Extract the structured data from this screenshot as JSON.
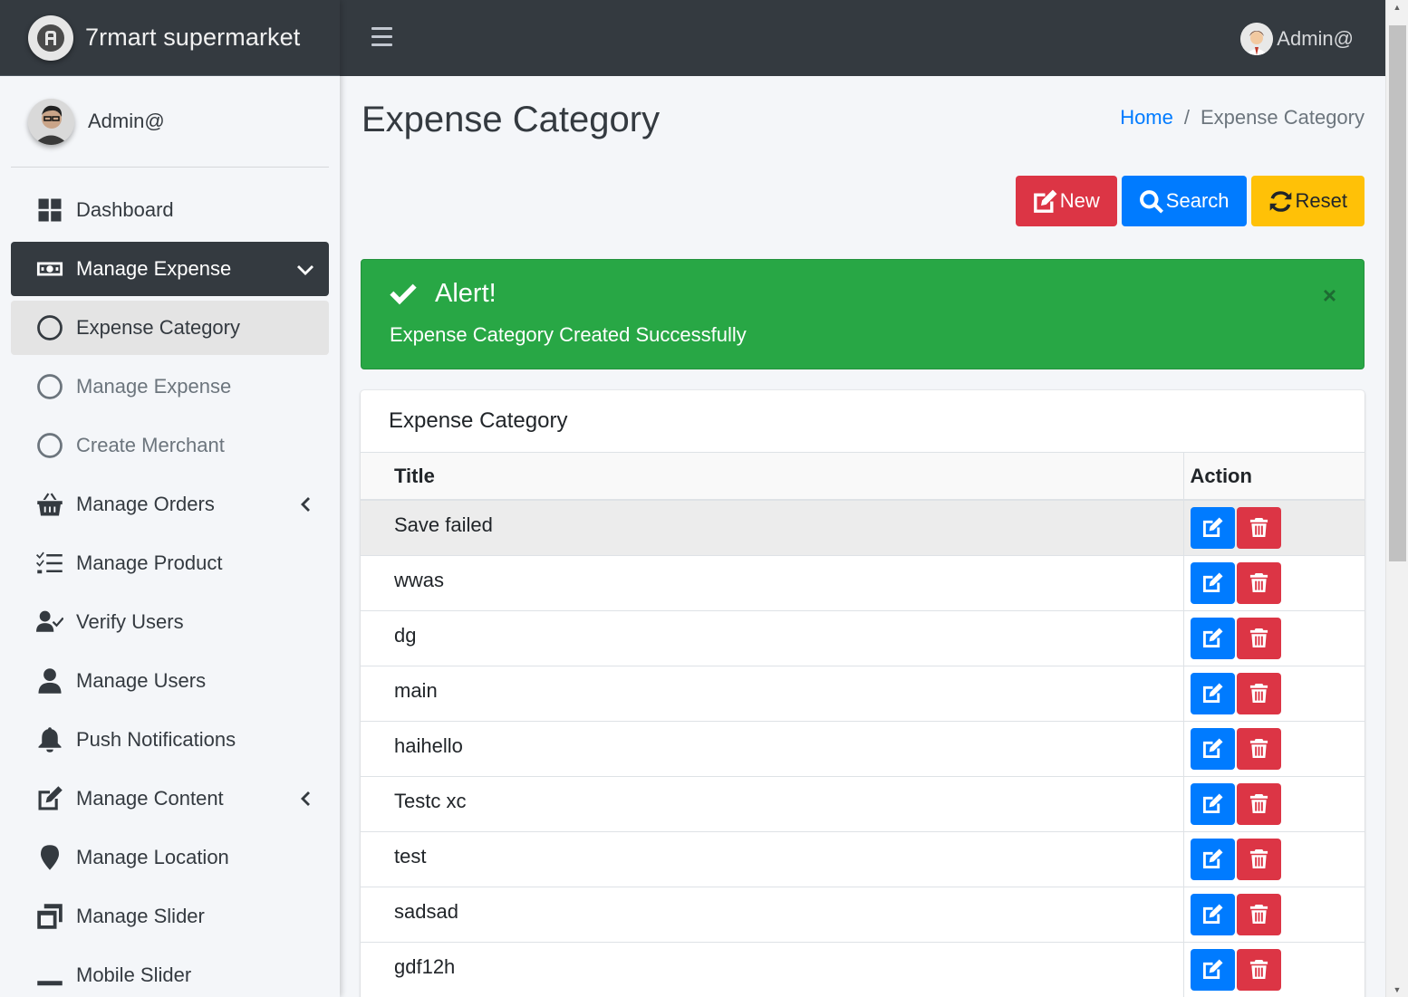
{
  "brand": {
    "name": "7rmart supermarket"
  },
  "user": {
    "name": "Admin@"
  },
  "topbar": {
    "user_name": "Admin@"
  },
  "sidebar": {
    "items": [
      {
        "label": "Dashboard",
        "icon": "dashboard-icon"
      },
      {
        "label": "Manage Expense",
        "icon": "money-bill-icon",
        "expanded": true
      },
      {
        "label": "Expense Category",
        "icon": "circle-icon"
      },
      {
        "label": "Manage Expense",
        "icon": "circle-icon"
      },
      {
        "label": "Create Merchant",
        "icon": "circle-icon"
      },
      {
        "label": "Manage Orders",
        "icon": "basket-icon"
      },
      {
        "label": "Manage Product",
        "icon": "tasks-icon"
      },
      {
        "label": "Verify Users",
        "icon": "user-check-icon"
      },
      {
        "label": "Manage Users",
        "icon": "user-icon"
      },
      {
        "label": "Push Notifications",
        "icon": "bell-icon"
      },
      {
        "label": "Manage Content",
        "icon": "edit-icon"
      },
      {
        "label": "Manage Location",
        "icon": "map-marker-icon"
      },
      {
        "label": "Manage Slider",
        "icon": "window-restore-icon"
      },
      {
        "label": "Mobile Slider",
        "icon": "minus-icon"
      }
    ]
  },
  "page": {
    "title": "Expense Category",
    "breadcrumb": {
      "home": "Home",
      "separator": "/",
      "current": "Expense Category"
    }
  },
  "actions": {
    "new_label": "New",
    "search_label": "Search",
    "reset_label": "Reset"
  },
  "alert": {
    "heading": "Alert!",
    "message": "Expense Category Created Successfully",
    "close": "×"
  },
  "table": {
    "card_title": "Expense Category",
    "columns": [
      "Title",
      "Action"
    ],
    "rows": [
      {
        "title": "Save failed"
      },
      {
        "title": "wwas"
      },
      {
        "title": "dg"
      },
      {
        "title": "main"
      },
      {
        "title": "haihello"
      },
      {
        "title": "Testc xc"
      },
      {
        "title": "test"
      },
      {
        "title": "sadsad"
      },
      {
        "title": "gdf12h"
      }
    ]
  },
  "colors": {
    "primary": "#007bff",
    "danger": "#dc3545",
    "warning": "#ffc107",
    "success": "#28a745",
    "dark": "#343a40"
  }
}
